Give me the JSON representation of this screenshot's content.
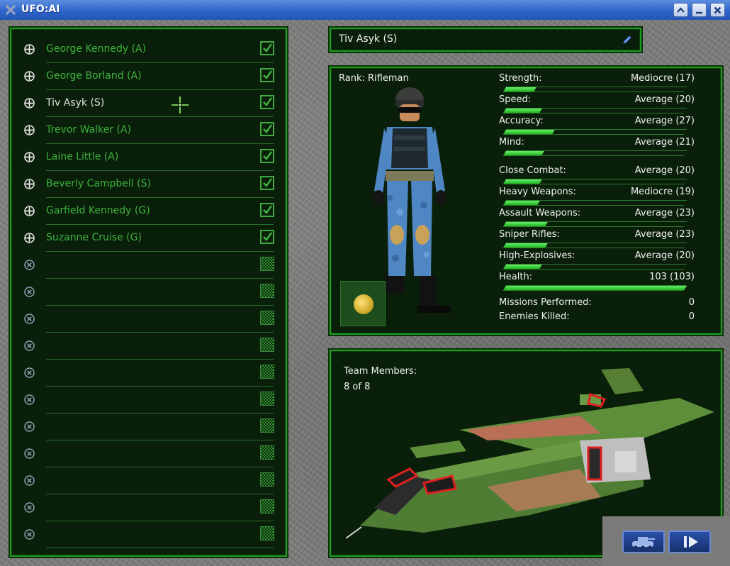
{
  "window": {
    "title": "UFO:AI"
  },
  "roster": {
    "soldiers": [
      {
        "name": "George Kennedy (A)",
        "selected": false
      },
      {
        "name": "George Borland (A)",
        "selected": false
      },
      {
        "name": "Tiv Asyk (S)",
        "selected": true
      },
      {
        "name": "Trevor Walker (A)",
        "selected": false
      },
      {
        "name": "Laine Little (A)",
        "selected": false
      },
      {
        "name": "Beverly Campbell (S)",
        "selected": false
      },
      {
        "name": "Garfield Kennedy (G)",
        "selected": false
      },
      {
        "name": "Suzanne Cruise (G)",
        "selected": false
      }
    ],
    "empty_slots": 11
  },
  "selected": {
    "name": "Tiv Asyk (S)",
    "rank": "Rank: Rifleman",
    "stats": [
      {
        "label": "Strength:",
        "value": "Mediocre (17)",
        "level": 0.17
      },
      {
        "label": "Speed:",
        "value": "Average (20)",
        "level": 0.2
      },
      {
        "label": "Accuracy:",
        "value": "Average (27)",
        "level": 0.27
      },
      {
        "label": "Mind:",
        "value": "Average (21)",
        "level": 0.21
      },
      {
        "label": "Close Combat:",
        "value": "Average (20)",
        "level": 0.2
      },
      {
        "label": "Heavy Weapons:",
        "value": "Mediocre (19)",
        "level": 0.19
      },
      {
        "label": "Assault Weapons:",
        "value": "Average (23)",
        "level": 0.23
      },
      {
        "label": "Sniper Rifles:",
        "value": "Average (23)",
        "level": 0.23
      },
      {
        "label": "High-Explosives:",
        "value": "Average (20)",
        "level": 0.2
      },
      {
        "label": "Health:",
        "value": "103 (103)",
        "level": 1.0
      }
    ],
    "missions_label": "Missions Performed:",
    "missions_value": "0",
    "kills_label": "Enemies Killed:",
    "kills_value": "0"
  },
  "team": {
    "label": "Team Members:",
    "value": "8 of 8"
  },
  "icons": {
    "add_soldier": "crosshair-plus-icon",
    "empty_slot": "circle-x-icon",
    "rename": "pencil-icon",
    "geoscape": "globe-icon",
    "vehicle": "tank-icon",
    "next": "play-next-icon"
  },
  "colors": {
    "accent": "#1f9a1f",
    "text_green": "#3db23d",
    "panel_bg": "#0a1f0a"
  }
}
